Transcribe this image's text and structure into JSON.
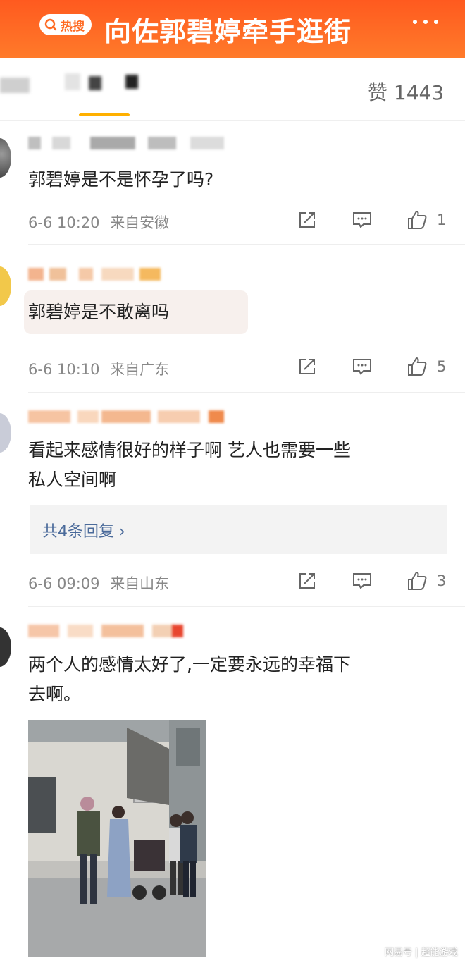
{
  "banner": {
    "badge_label": "热搜",
    "title": "向佐郭碧婷牵手逛街"
  },
  "header": {
    "likes_label": "赞 1443"
  },
  "comments": [
    {
      "text": "郭碧婷是不是怀孕了吗?",
      "time": "6-6 10:20",
      "location": "来自安徽",
      "likes": "1"
    },
    {
      "text": "郭碧婷是不敢离吗",
      "time": "6-6 10:10",
      "location": "来自广东",
      "likes": "5"
    },
    {
      "text_line1": "看起来感情很好的样子啊 艺人也需要一些",
      "text_line2": "私人空间啊",
      "reply_label": "共4条回复 ›",
      "time": "6-6 09:09",
      "location": "来自山东",
      "likes": "3"
    },
    {
      "text_line1": "两个人的感情太好了,一定要永远的幸福下",
      "text_line2": "去啊。"
    }
  ],
  "footer": {
    "watermark": "网易号 | 超能游戏"
  },
  "colors": {
    "banner": "#ff6a22",
    "tab_underline": "#ffb000",
    "reply_link": "#4a6a9a"
  }
}
